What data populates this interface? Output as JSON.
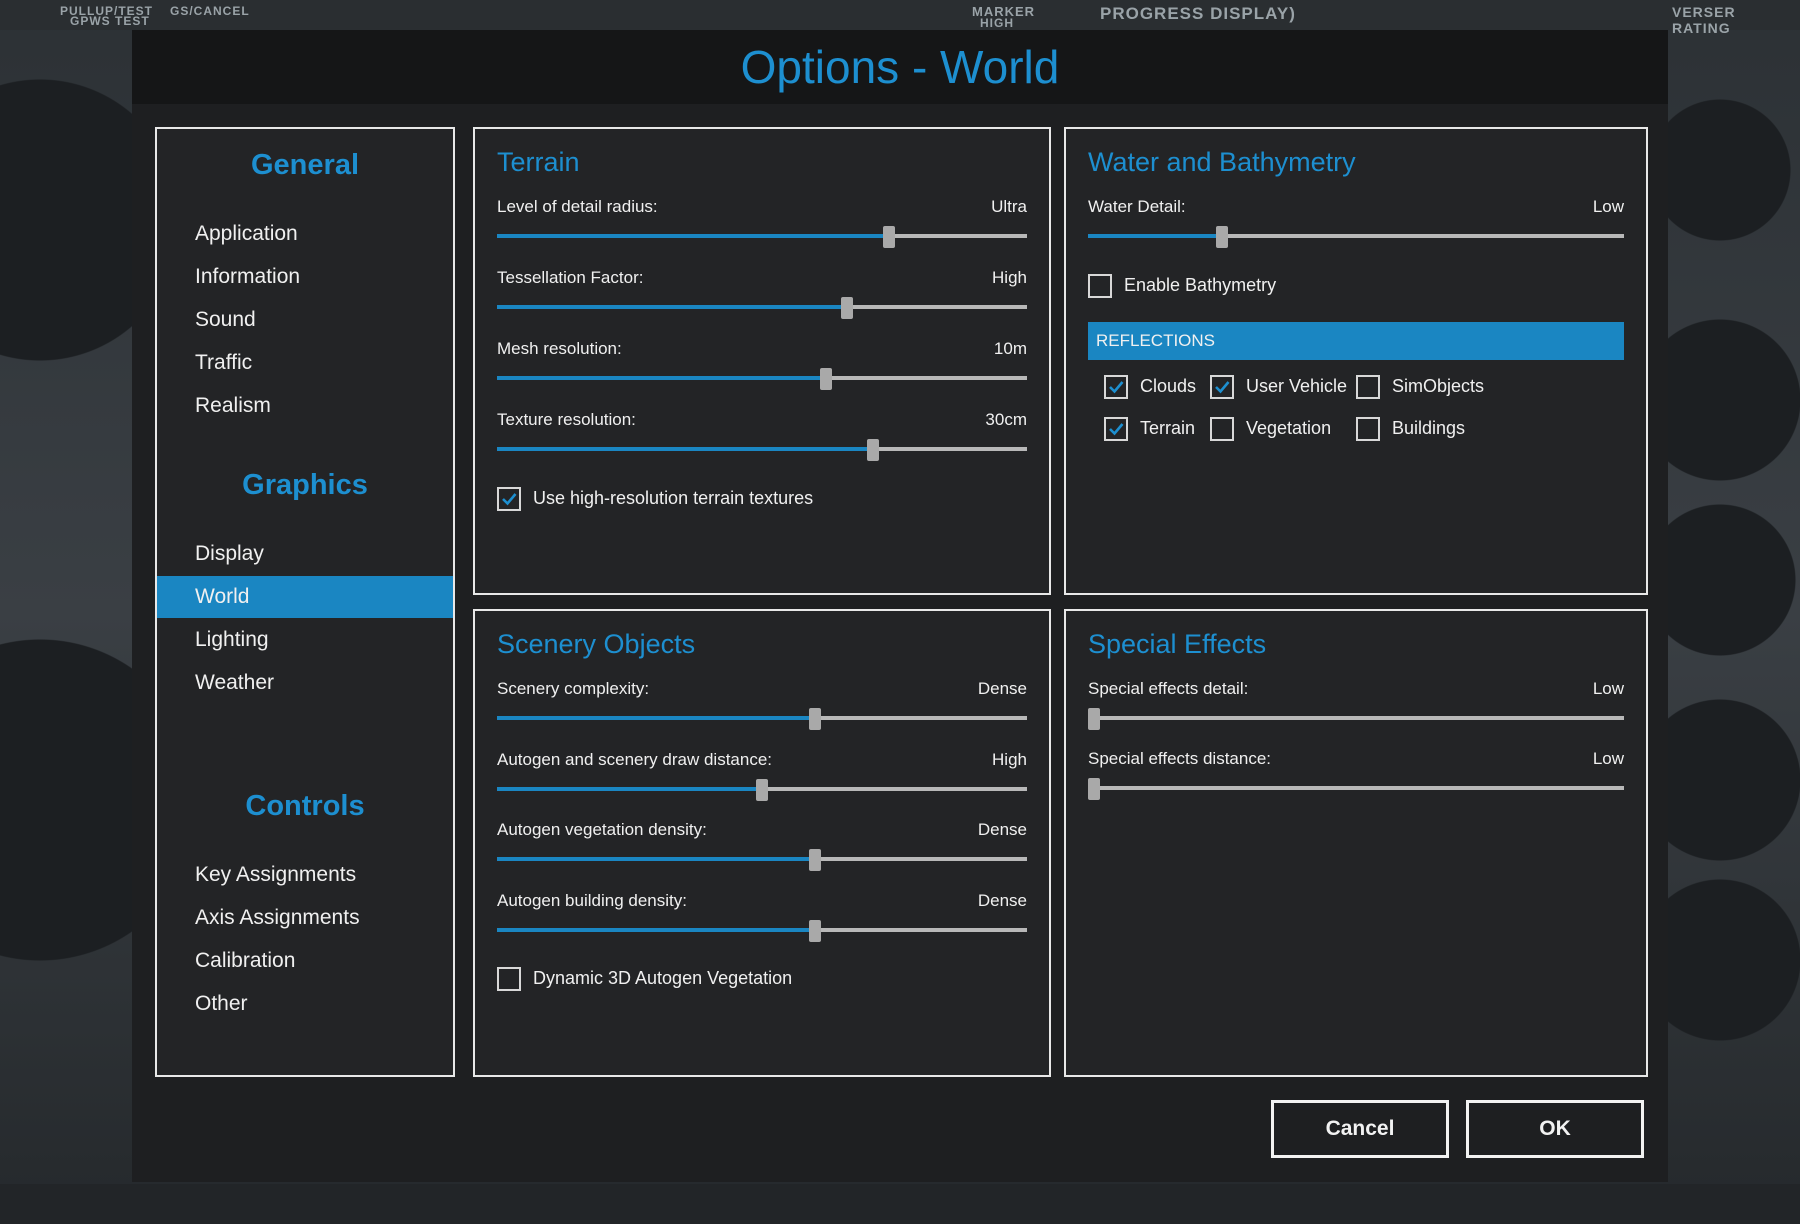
{
  "background": {
    "labels": [
      "PULLUP/TEST",
      "GS/CANCEL",
      "GPWS TEST",
      "MARKER",
      "HIGH",
      "PROGRESS DISPLAY)",
      "VERSER",
      "RATING"
    ]
  },
  "dialog": {
    "title": "Options - World"
  },
  "nav": {
    "sections": [
      {
        "heading": "General",
        "items": [
          "Application",
          "Information",
          "Sound",
          "Traffic",
          "Realism"
        ]
      },
      {
        "heading": "Graphics",
        "items": [
          "Display",
          "World",
          "Lighting",
          "Weather"
        ]
      },
      {
        "heading": "Controls",
        "items": [
          "Key Assignments",
          "Axis Assignments",
          "Calibration",
          "Other"
        ]
      }
    ],
    "active": "World"
  },
  "terrain": {
    "title": "Terrain",
    "sliders": [
      {
        "label": "Level of detail radius:",
        "value": "Ultra",
        "level": 0.74
      },
      {
        "label": "Tessellation Factor:",
        "value": "High",
        "level": 0.66
      },
      {
        "label": "Mesh resolution:",
        "value": "10m",
        "level": 0.62
      },
      {
        "label": "Texture resolution:",
        "value": "30cm",
        "level": 0.71
      }
    ],
    "checkbox": {
      "label": "Use high-resolution terrain textures",
      "checked": true
    }
  },
  "water": {
    "title": "Water and Bathymetry",
    "slider": {
      "label": "Water Detail:",
      "value": "Low",
      "level": 0.25
    },
    "bathymetry": {
      "label": "Enable Bathymetry",
      "checked": false
    },
    "reflections_header": "REFLECTIONS",
    "reflections": [
      {
        "label": "Clouds",
        "checked": true
      },
      {
        "label": "User Vehicle",
        "checked": true
      },
      {
        "label": "SimObjects",
        "checked": false
      },
      {
        "label": "Terrain",
        "checked": true
      },
      {
        "label": "Vegetation",
        "checked": false
      },
      {
        "label": "Buildings",
        "checked": false
      }
    ]
  },
  "scenery": {
    "title": "Scenery Objects",
    "sliders": [
      {
        "label": "Scenery complexity:",
        "value": "Dense",
        "level": 0.6
      },
      {
        "label": "Autogen and scenery draw distance:",
        "value": "High",
        "level": 0.5
      },
      {
        "label": "Autogen vegetation density:",
        "value": "Dense",
        "level": 0.6
      },
      {
        "label": "Autogen building density:",
        "value": "Dense",
        "level": 0.6
      }
    ],
    "checkbox": {
      "label": "Dynamic 3D Autogen Vegetation",
      "checked": false
    }
  },
  "effects": {
    "title": "Special Effects",
    "sliders": [
      {
        "label": "Special effects detail:",
        "value": "Low",
        "level": 0.0
      },
      {
        "label": "Special effects distance:",
        "value": "Low",
        "level": 0.0
      }
    ]
  },
  "buttons": {
    "cancel": "Cancel",
    "ok": "OK"
  },
  "colors": {
    "accent": "#1a86c2",
    "title": "#1d8fd0",
    "panel_bg": "#232426"
  }
}
